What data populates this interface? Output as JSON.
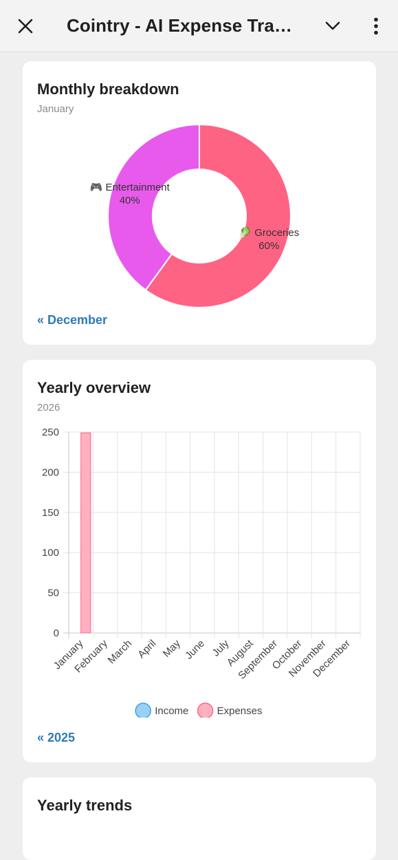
{
  "app_bar": {
    "title": "Cointry - AI Expense Trac...",
    "close_icon": "close-icon",
    "chevron_icon": "chevron-down-icon",
    "more_icon": "more-vert-icon"
  },
  "monthly": {
    "title": "Monthly breakdown",
    "subtitle": "January",
    "prev_link": "« December",
    "chart_data": {
      "type": "pie",
      "slices": [
        {
          "label": "Groceries",
          "emoji": "🥬",
          "value": 60,
          "pct_label": "60%",
          "color": "#ff6384"
        },
        {
          "label": "Entertainment",
          "emoji": "🎮",
          "value": 40,
          "pct_label": "40%",
          "color": "#e85aec"
        }
      ]
    }
  },
  "yearly": {
    "title": "Yearly overview",
    "subtitle": "2026",
    "prev_link": "« 2025",
    "chart_data": {
      "type": "bar",
      "categories": [
        "January",
        "February",
        "March",
        "April",
        "May",
        "June",
        "July",
        "August",
        "September",
        "October",
        "November",
        "December"
      ],
      "series": [
        {
          "name": "Income",
          "values": [
            0,
            0,
            0,
            0,
            0,
            0,
            0,
            0,
            0,
            0,
            0,
            0
          ],
          "color": "#9ad0f5",
          "border": "#36a2eb"
        },
        {
          "name": "Expenses",
          "values": [
            249,
            0,
            0,
            0,
            0,
            0,
            0,
            0,
            0,
            0,
            0,
            0
          ],
          "color": "#ffb1c1",
          "border": "#ff6384"
        }
      ],
      "ylim": [
        0,
        250
      ],
      "yticks": [
        0,
        50,
        100,
        150,
        200,
        250
      ],
      "grid": true,
      "legend": "bottom"
    }
  },
  "trends": {
    "title": "Yearly trends"
  }
}
